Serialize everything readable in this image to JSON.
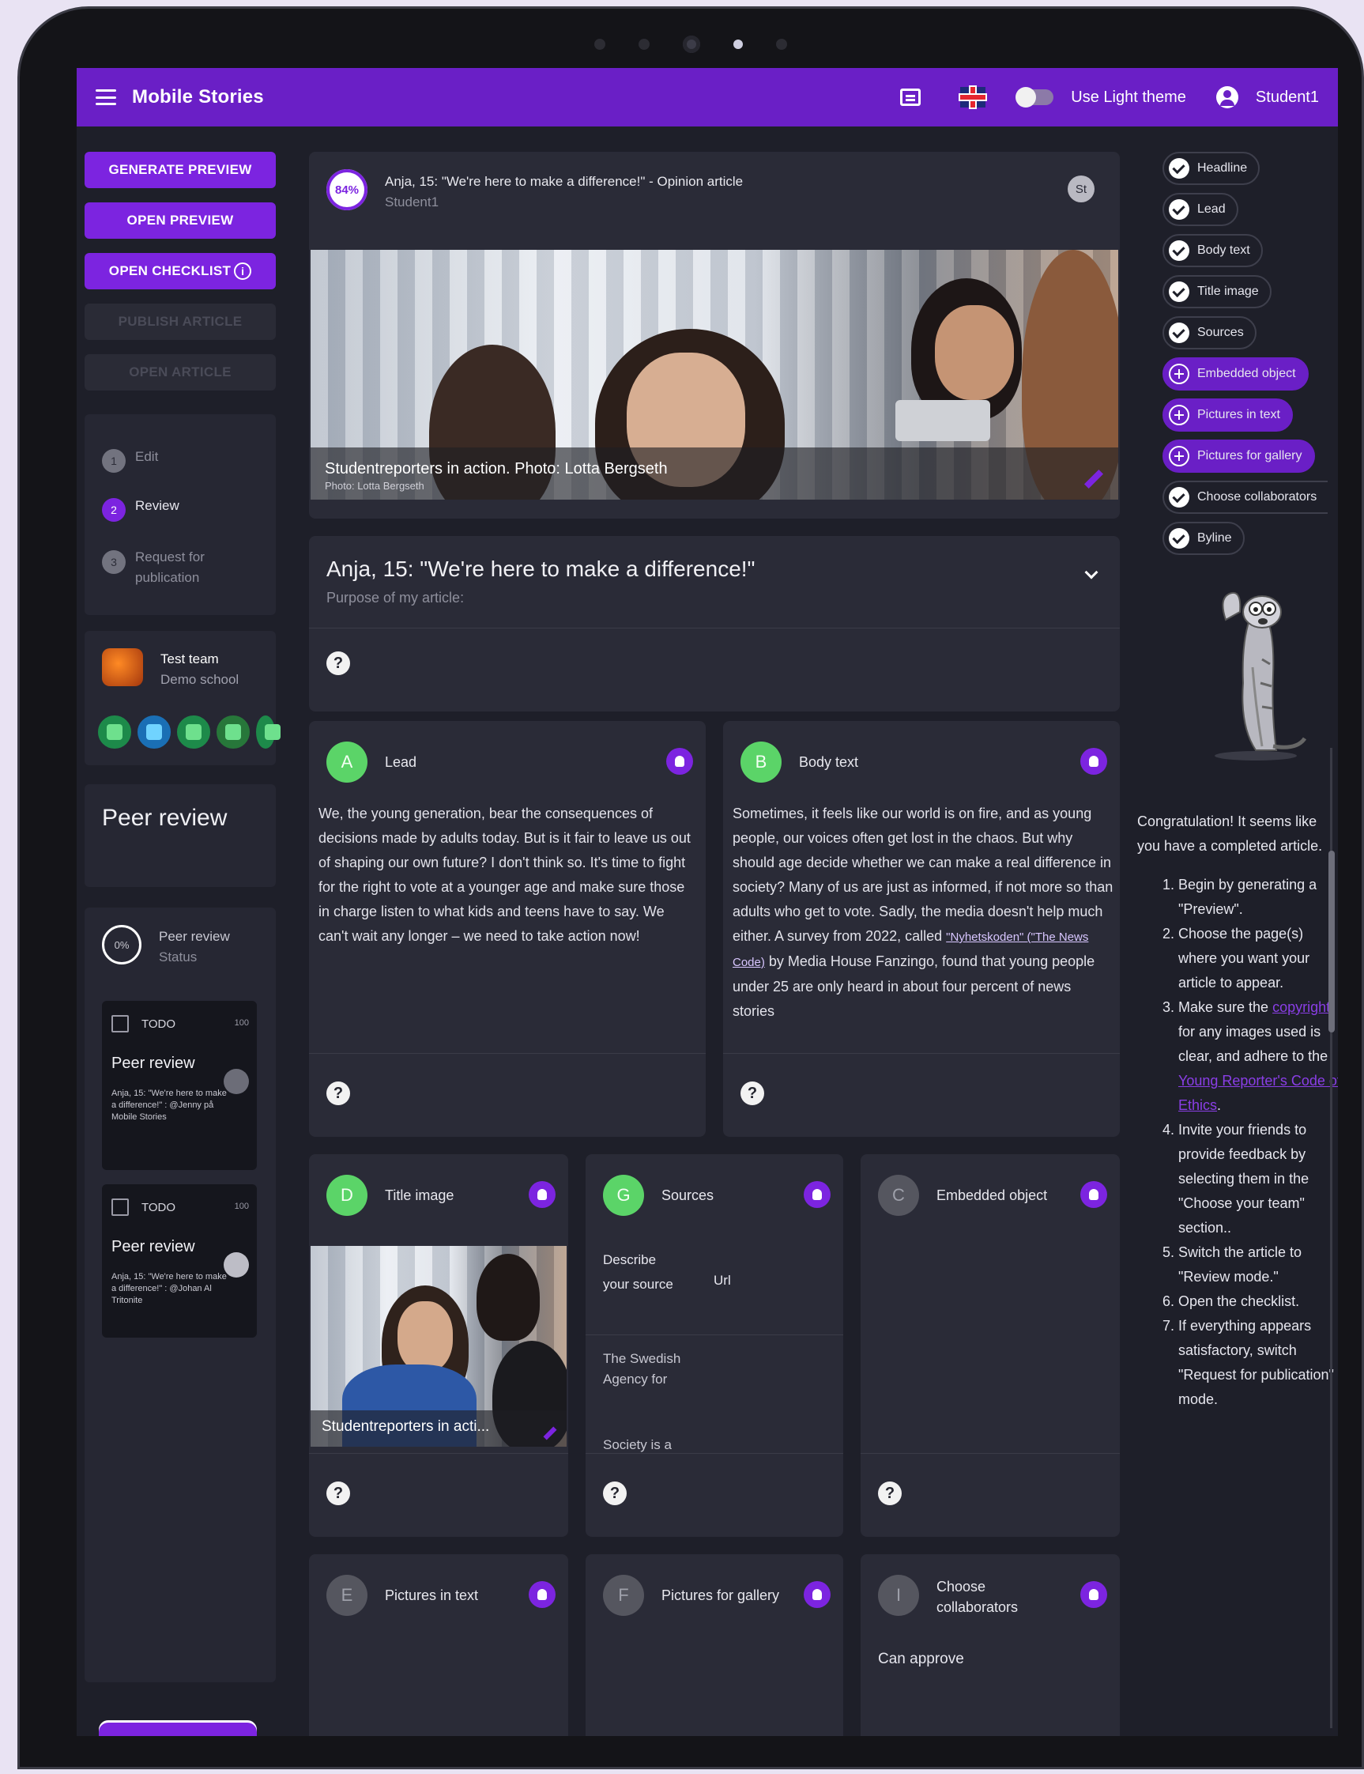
{
  "app": {
    "title": "Mobile Stories",
    "theme_label": "Use Light theme",
    "user": "Student1"
  },
  "actions": {
    "generate_preview": "GENERATE PREVIEW",
    "open_preview": "OPEN PREVIEW",
    "open_checklist": "OPEN CHECKLIST",
    "publish_article": "PUBLISH ARTICLE",
    "open_article": "OPEN ARTICLE"
  },
  "steps": [
    {
      "num": "1",
      "label": "Edit",
      "active": false
    },
    {
      "num": "2",
      "label": "Review",
      "active": true
    },
    {
      "num": "3",
      "label": "Request for publication",
      "active": false
    }
  ],
  "team": {
    "name": "Test team",
    "school": "Demo school"
  },
  "peer_review": {
    "title": "Peer review",
    "status_pct": "0%",
    "status_label": "Peer review",
    "status_sub": "Status",
    "todos": [
      {
        "state": "TODO",
        "pct": "100",
        "title": "Peer review",
        "text": "Anja, 15: \"We're here to make a difference!\" : @Jenny på Mobile Stories"
      },
      {
        "state": "TODO",
        "pct": "100",
        "title": "Peer review",
        "text": "Anja, 15: \"We're here to make a difference!\" : @Johan Al Tritonite"
      }
    ]
  },
  "article": {
    "progress": "84%",
    "header_title": "Anja, 15: \"We're here to make a difference!\" - Opinion article",
    "author": "Student1",
    "author_badge": "St",
    "image_caption": "Studentreporters in action. Photo: Lotta Bergseth",
    "image_credit": "Photo: Lotta Bergseth",
    "headline": "Anja, 15: \"We're here to make a difference!\"",
    "purpose_label": "Purpose of my article:"
  },
  "sections": {
    "lead": {
      "letter": "A",
      "title": "Lead",
      "text": "We, the young generation, bear the consequences of decisions made by adults today. But is it fair to leave us out of shaping our own future? I don't think so. It's time to fight for the right to vote at a younger age and make sure those in charge listen to what kids and teens have to say. We can't wait any longer – we need to take action now!"
    },
    "body": {
      "letter": "B",
      "title": "Body text",
      "text_before": "Sometimes, it feels like our world is on fire, and as young people, our voices often get lost in the chaos. But why should age decide whether we can make a real difference in society? Many of us are just as informed, if not more so than adults who get to vote. Sadly, the media doesn't help much either. A survey from 2022, called",
      "link": "\"Nyhetskoden\" (\"The News Code)",
      "text_after": "by Media House Fanzingo, found that young people under 25 are only heard in about four percent of news stories"
    },
    "title_image": {
      "letter": "D",
      "title": "Title image",
      "caption": "Studentreporters in acti..."
    },
    "sources": {
      "letter": "G",
      "title": "Sources",
      "col_describe": "Describe your source",
      "col_url": "Url",
      "row1": "The Swedish Agency for",
      "row2": "Society is a"
    },
    "embedded": {
      "letter": "C",
      "title": "Embedded object"
    },
    "pictures_text": {
      "letter": "E",
      "title": "Pictures in text"
    },
    "pictures_gallery": {
      "letter": "F",
      "title": "Pictures for gallery"
    },
    "collaborators": {
      "letter": "I",
      "title": "Choose collaborators",
      "text": "Can approve"
    }
  },
  "checklist": [
    {
      "label": "Headline",
      "done": true
    },
    {
      "label": "Lead",
      "done": true
    },
    {
      "label": "Body text",
      "done": true
    },
    {
      "label": "Title image",
      "done": true
    },
    {
      "label": "Sources",
      "done": true
    },
    {
      "label": "Embedded object",
      "done": false
    },
    {
      "label": "Pictures in text",
      "done": false
    },
    {
      "label": "Pictures for gallery",
      "done": false
    },
    {
      "label": "Choose collaborators",
      "done": true
    },
    {
      "label": "Byline",
      "done": true
    }
  ],
  "guide": {
    "intro": "Congratulation! It seems like you have a completed article.",
    "step1": "Begin by generating a \"Preview\".",
    "step2": "Choose the page(s) where you want your article to appear.",
    "step3_a": "Make sure the",
    "step3_link1": "copyright",
    "step3_b": "for any images used is clear, and adhere to the",
    "step3_link2": "Young Reporter's Code of Ethics",
    "step3_c": ".",
    "step4": "Invite your friends to provide feedback by selecting them in the \"Choose your team\" section..",
    "step5": "Switch the article to \"Review mode.\"",
    "step6": "Open the checklist.",
    "step7": "If everything appears satisfactory, switch \"Request for publication\" mode."
  },
  "colors": {
    "accent": "#7c24e0",
    "appbar": "#6a1fc6",
    "background": "#1e1f29",
    "card": "#2a2b37",
    "done": "#5bd468"
  }
}
